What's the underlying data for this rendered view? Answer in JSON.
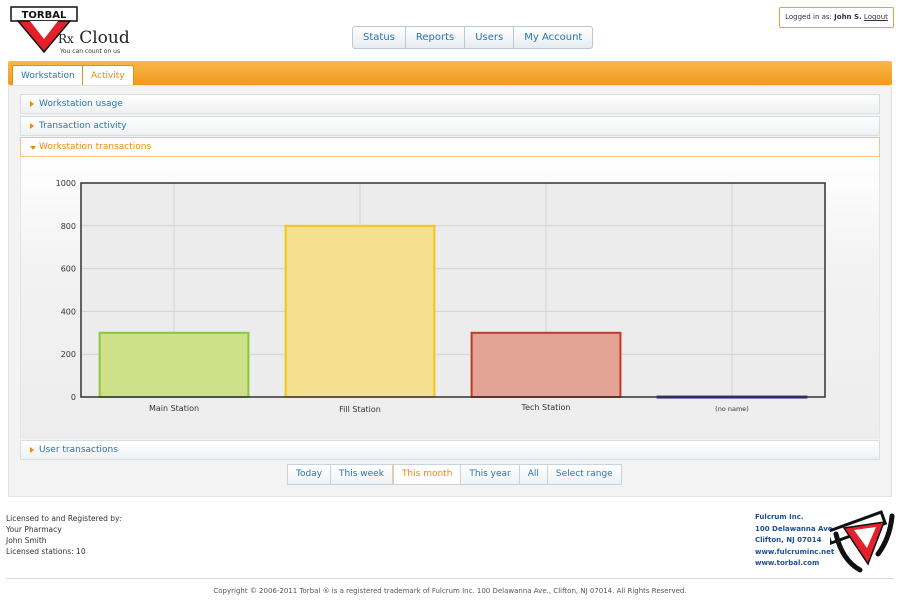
{
  "brand": {
    "logo_text": "TORBAL",
    "product_prefix": "Rx",
    "product_name": "Cloud",
    "tagline": "You can count on us"
  },
  "topnav": {
    "items": [
      "Status",
      "Reports",
      "Users",
      "My Account"
    ]
  },
  "login": {
    "prefix": "Logged in as:",
    "user": "John S.",
    "logout": "Logout"
  },
  "tabs": [
    {
      "label": "Workstation",
      "active": false
    },
    {
      "label": "Activity",
      "active": true
    }
  ],
  "accordion": {
    "workstation_usage": "Workstation usage",
    "transaction_activity": "Transaction activity",
    "workstation_transactions": "Workstation transactions",
    "user_transactions": "User transactions"
  },
  "chart_data": {
    "type": "bar",
    "title": "",
    "xlabel": "",
    "ylabel": "",
    "categories": [
      "Main Station",
      "Fill Station",
      "Tech Station",
      "(no name)"
    ],
    "values": [
      300,
      800,
      300,
      2
    ],
    "ylim": [
      0,
      1000
    ],
    "yticks": [
      0,
      200,
      400,
      600,
      800,
      1000
    ],
    "grid": true,
    "legend": "none",
    "colors": {
      "fills": [
        "#cde08a",
        "#f6df8e",
        "#e3a395",
        "#4444aa"
      ],
      "strokes": [
        "#8cc63f",
        "#f5c518",
        "#c0392b",
        "#333399"
      ]
    }
  },
  "range_buttons": {
    "items": [
      "Today",
      "This week",
      "This month",
      "This year",
      "All",
      "Select range"
    ],
    "active_index": 2
  },
  "license": {
    "heading": "Licensed to and Registered by:",
    "company": "Your Pharmacy",
    "person": "John Smith",
    "stations": "Licensed stations: 10"
  },
  "company_info": {
    "name": "Fulcrum Inc.",
    "address1": "100 Delawanna Ave.",
    "address2": "Clifton, NJ 07014",
    "website1": "www.fulcruminc.net",
    "website2": "www.torbal.com"
  },
  "footer": {
    "copyright": "Copyright © 2006-2011 Torbal ® is a registered trademark of Fulcrum Inc. 100 Delawanna Ave., Clifton, NJ 07014. All Rights Reserved."
  },
  "colors": {
    "accent": "#f29a1e",
    "link": "#2a74b0",
    "active": "#f08a00"
  }
}
